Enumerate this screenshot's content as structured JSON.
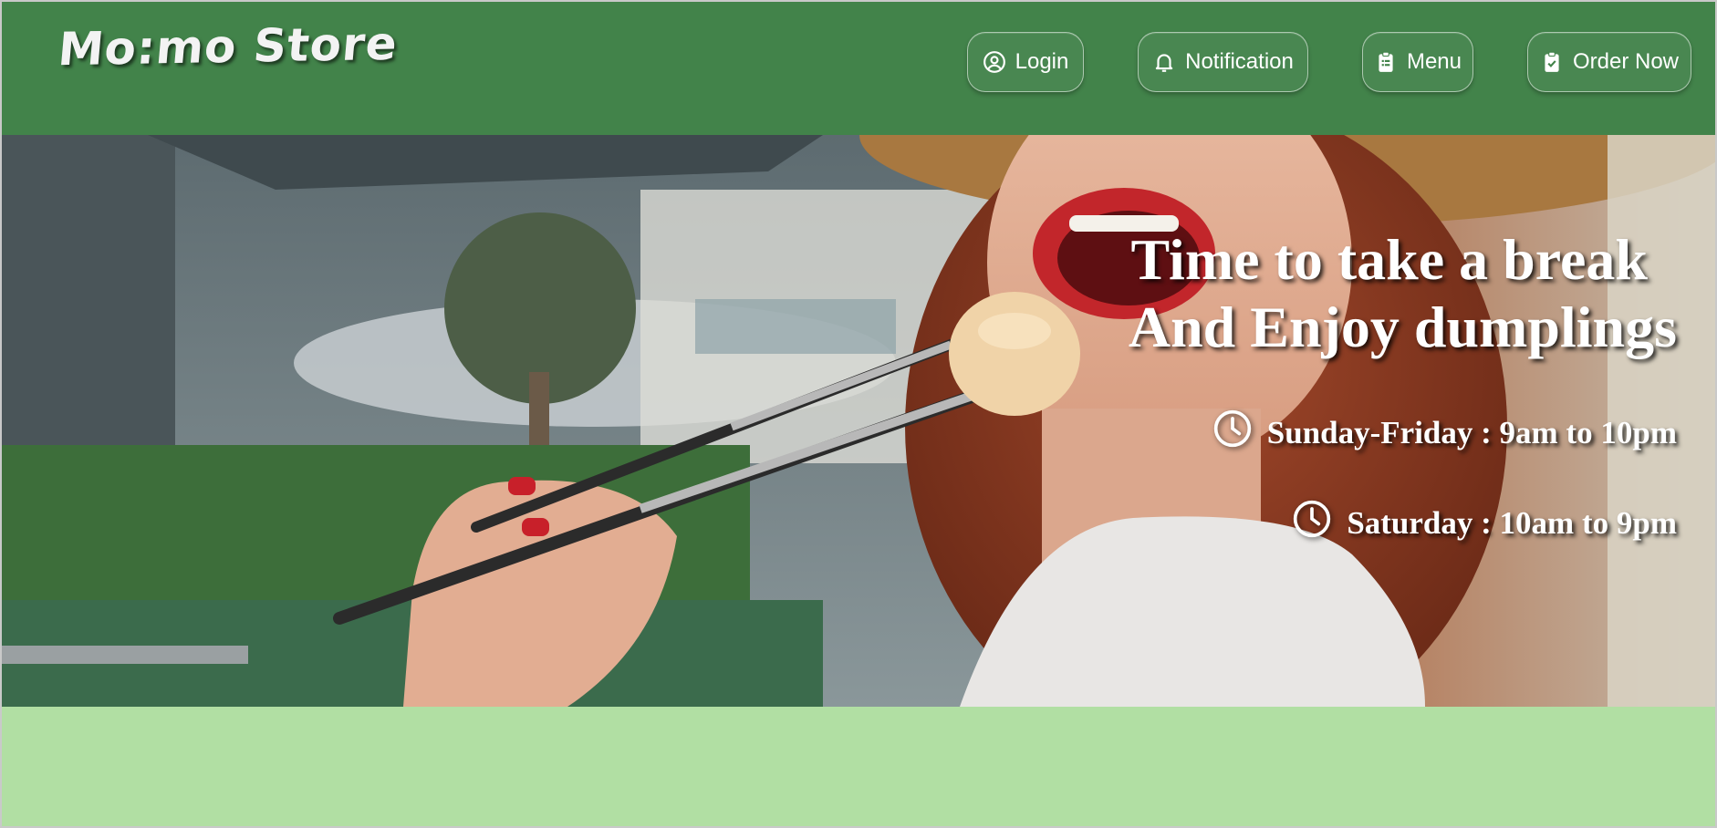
{
  "header": {
    "logo": "Mo:mo Store",
    "nav": [
      {
        "label": "Login",
        "icon": "user-circle-icon"
      },
      {
        "label": "Notification",
        "icon": "bell-icon"
      },
      {
        "label": "Menu",
        "icon": "clipboard-list-icon"
      },
      {
        "label": "Order Now",
        "icon": "clipboard-check-icon"
      }
    ]
  },
  "hero": {
    "headline_line1": "Time to take a break",
    "headline_line2": "And Enjoy dumplings",
    "hours": [
      {
        "text": "Sunday-Friday : 9am to 10pm",
        "icon": "clock-icon"
      },
      {
        "text": "Saturday : 10am to 9pm",
        "icon": "clock-icon"
      }
    ]
  },
  "colors": {
    "header_bg": "#42834a",
    "band_bg": "#b1dfa3",
    "text": "#ffffff"
  }
}
